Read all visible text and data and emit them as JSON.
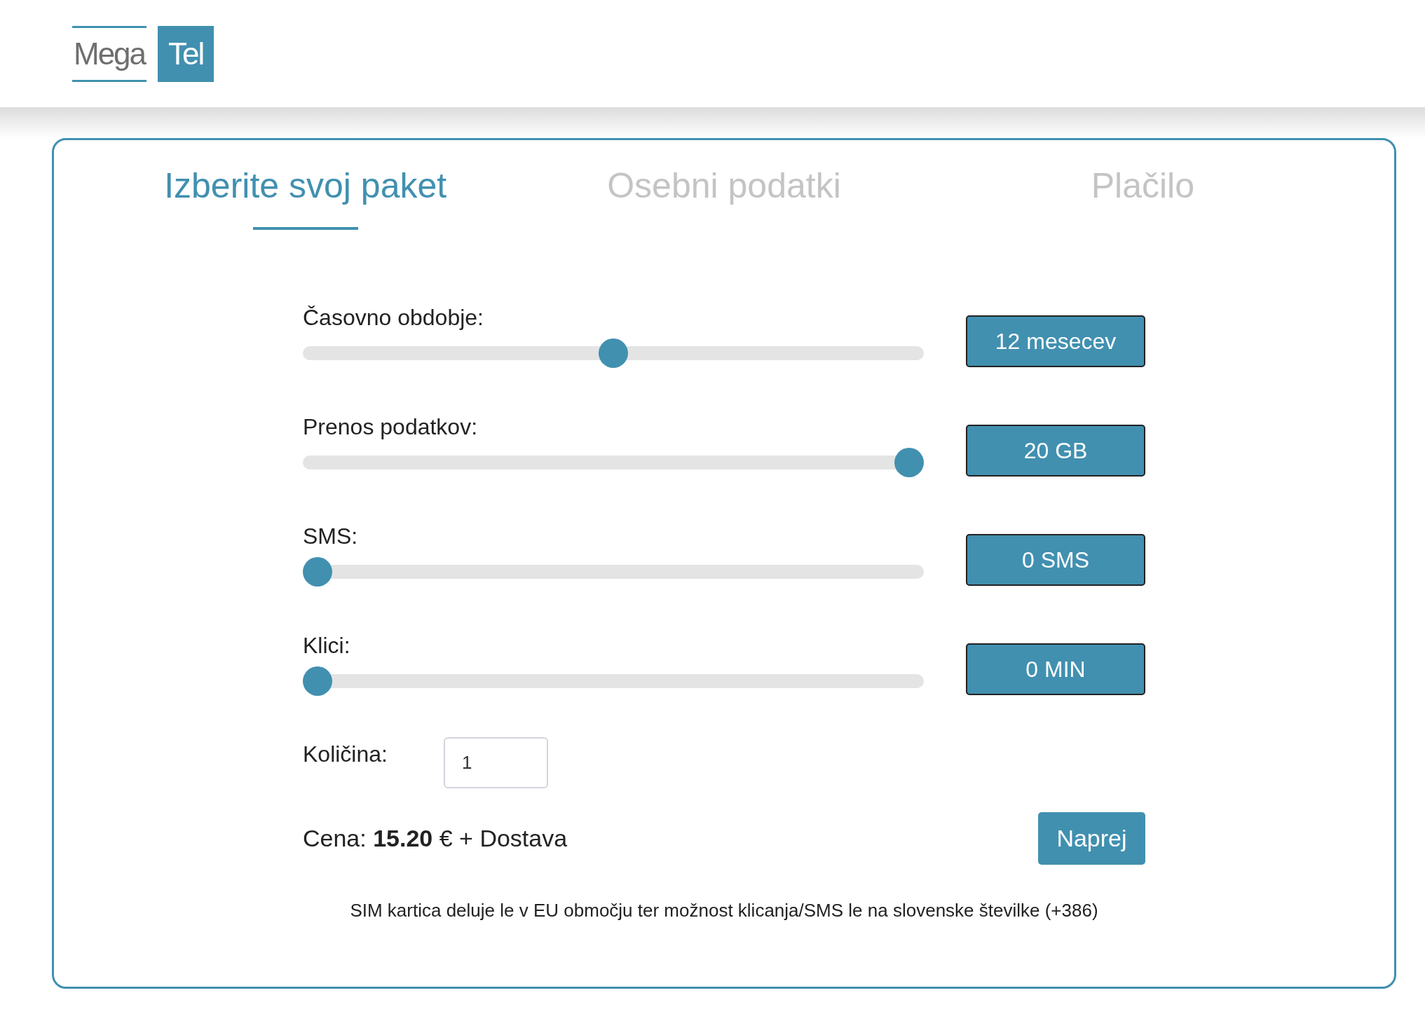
{
  "logo": {
    "left": "Mega",
    "right": "Tel"
  },
  "steps": [
    {
      "label": "Izberite svoj paket",
      "selected": true
    },
    {
      "label": "Osebni podatki",
      "selected": false
    },
    {
      "label": "Plačilo",
      "selected": false
    }
  ],
  "sliders": [
    {
      "label": "Časovno obdobje:",
      "level": 0.5,
      "value": "12 mesecev"
    },
    {
      "label": "Prenos podatkov:",
      "level": 1,
      "value": "20 GB"
    },
    {
      "label": "SMS:",
      "level": 0,
      "value": "0 SMS"
    },
    {
      "label": "Klici:",
      "level": 0,
      "value": "0 MIN"
    }
  ],
  "quantity": {
    "label": "Količina:",
    "value": "1"
  },
  "price": "Cena: **15.20** € + Dostava",
  "next_button": "Naprej",
  "note": "SIM kartica deluje le v EU območju ter možnost klicanja/SMS le na slovenske številke (+386)"
}
